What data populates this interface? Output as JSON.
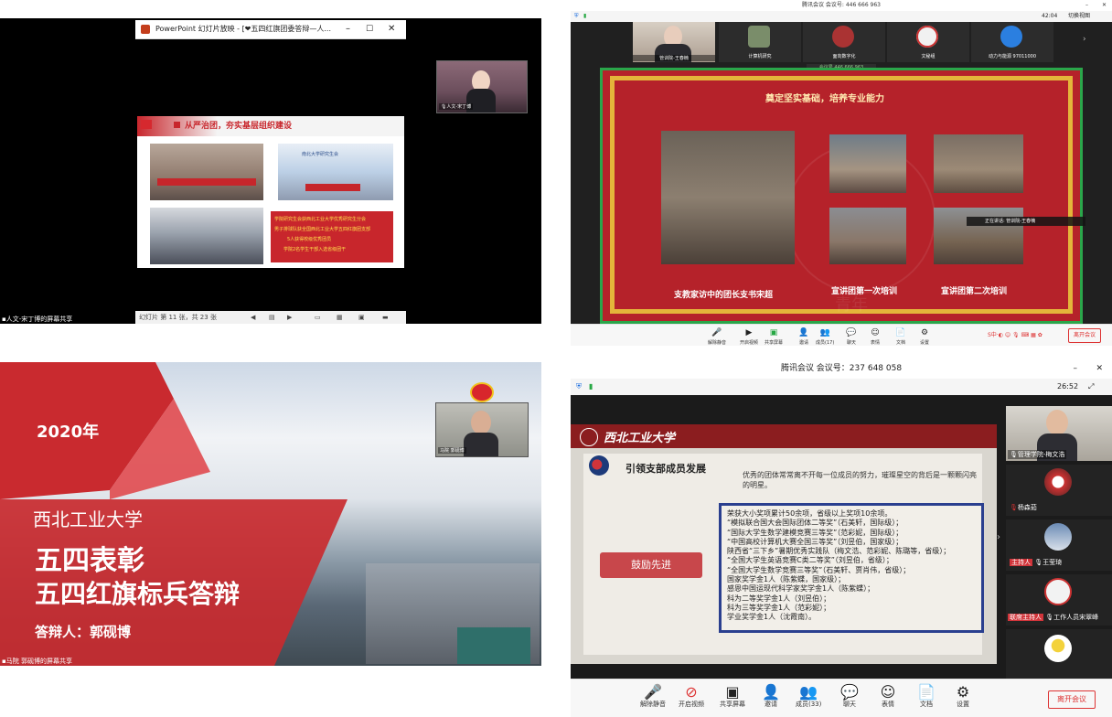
{
  "panel1": {
    "ppt_title": "PowerPoint 幻灯片放映 - [❤五四红旗团委答辩—人...",
    "slide_heading": "从严治团，夯实基层组织建设",
    "photo2_caption": "南北大学研究生会",
    "bullets": [
      "学院研究生会获西北工业大学优秀研究生分会",
      "男子排球队获全国西北工业大学五四红旗团支部",
      "5人获得校级优秀团员",
      "学院2名学生干部入选省级团干"
    ],
    "slide_counter": "幻灯片 第 11 张，共 23 张",
    "participant_label": "人文-宋丁博",
    "share_label": "人文-宋丁博的屏幕共享"
  },
  "panel2": {
    "window_title": "腾讯会议 会议号: 446 666 963",
    "time": "42:04",
    "switch_view": "切换视图",
    "participants": [
      {
        "name": "管训院-王春楠"
      },
      {
        "name": "计算机研究"
      },
      {
        "name": "面向数字化"
      },
      {
        "name": "文秘组"
      },
      {
        "name": "动力与能源 97011000"
      }
    ],
    "meeting_id_bar": "会议号 446 666 963",
    "slide_title": "奠定坚实基础，培养专业能力",
    "overlay_tag": "正在讲话: 管训院-王春楠",
    "captions": [
      "支教家访中的团长支书宋超",
      "宣讲团第一次培训",
      "宣讲团第二次培训"
    ],
    "watermark": "青年",
    "toolbar": [
      "解除静音",
      "开启视频",
      "共享屏幕",
      "邀请",
      "成员(17)",
      "聊天",
      "表情",
      "文档",
      "设置"
    ],
    "leave": "离开会议"
  },
  "panel3": {
    "year": "2020年",
    "university": "西北工业大学",
    "title1": "五四表彰",
    "title2": "五四红旗标兵答辩",
    "speaker": "答辩人：郭砚博",
    "cam_label": "马院 郭砚博",
    "share_label": "马院 郭砚博的屏幕共享"
  },
  "panel4": {
    "window_title": "腾讯会议 会议号：237 648 058",
    "time": "26:52",
    "banner_text": "西北工业大学",
    "heading": "引领支部成员发展",
    "quote": "优秀的团体常常离不开每一位成员的努力，璀璨星空的背后是一颗颗闪亮的明星。",
    "button": "鼓励先进",
    "awards_lines": [
      "荣获大小奖项累计50余项，省级以上奖项10余项。",
      "“模拟联合国大会国际团体二等奖”（石美轩，国际级）；",
      "“国际大学生数学建模竞赛三等奖”（范彩妮，国际级）；",
      "“中国高校计算机大赛全国三等奖”（刘昱伯，国家级）；",
      "陕西省“三下乡”暑期优秀实践队（梅文浩、范彩妮、陈璐等，省级）；",
      "“全国大学生英语竞赛C类二等奖”（刘昱伯，省级）；",
      "“全国大学生数学竞赛三等奖”（石美轩、贾肖伟，省级）；",
      "国家奖学金1人（陈紫蝶，国家级）；",
      "感恩中国运现代科学家奖学金1人（陈紫蝶）；",
      "科为二等奖学金1人（刘昱伯）；",
      "科为三等奖学金1人（范彩妮）；",
      "学业奖学金1人（沈霞南）。"
    ],
    "participants": [
      {
        "name": "管理学院-梅文浩",
        "tag": ""
      },
      {
        "name": "杨森茹",
        "tag": ""
      },
      {
        "name": "王莹琦",
        "tag": "主持人"
      },
      {
        "name": "工作人员宋翠峰",
        "tag": "联席主持人"
      },
      {
        "name": "",
        "tag": ""
      }
    ],
    "toolbar": [
      "解除静音",
      "开启视频",
      "共享屏幕",
      "邀请",
      "成员(33)",
      "聊天",
      "表情",
      "文档",
      "设置"
    ],
    "leave": "离开会议",
    "brand_red": "#d1343a",
    "banner_color": "#8b1d1f"
  }
}
